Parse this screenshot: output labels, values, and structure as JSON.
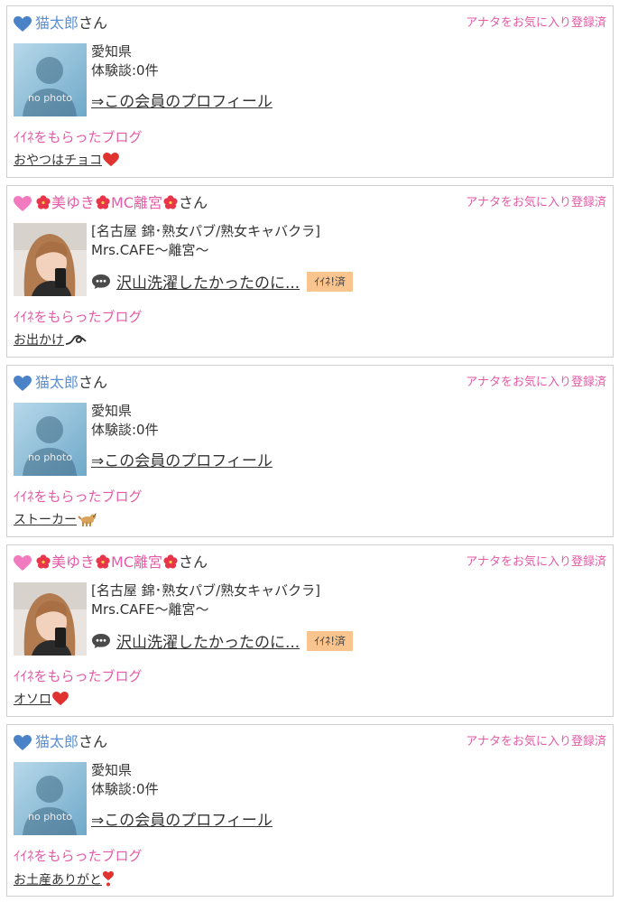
{
  "common": {
    "fav_label": "アナタをお気に入り登録済",
    "received_label": "ｲｲﾈをもらったブログ",
    "san": "さん",
    "profile_link": "⇒この会員のプロフィール",
    "nophoto_text": "no photo"
  },
  "cards": [
    {
      "type": "member",
      "heart": "blue-heart-icon",
      "name": "猫太郎",
      "area": "愛知県",
      "reviews": "体験談:0件",
      "post": "おやつはチョコ",
      "post_emoji": "red-heart-icon"
    },
    {
      "type": "cast",
      "heart": "pink-heart-icon",
      "name_parts": [
        "美ゆき",
        "MC離宮"
      ],
      "shop_category": "[名古屋 錦･熟女パブ/熟女キャバクラ]",
      "shop_name": "Mrs.CAFE〜離宮〜",
      "blog_title": "沢山洗濯したかったのに...",
      "iine_badge": "ｲｲﾈ!済",
      "post": "お出かけ",
      "post_emoji": "curly-loop-icon"
    },
    {
      "type": "member",
      "heart": "blue-heart-icon",
      "name": "猫太郎",
      "area": "愛知県",
      "reviews": "体験談:0件",
      "post": "ストーカー",
      "post_emoji": "dog-icon"
    },
    {
      "type": "cast",
      "heart": "pink-heart-icon",
      "name_parts": [
        "美ゆき",
        "MC離宮"
      ],
      "shop_category": "[名古屋 錦･熟女パブ/熟女キャバクラ]",
      "shop_name": "Mrs.CAFE〜離宮〜",
      "blog_title": "沢山洗濯したかったのに...",
      "iine_badge": "ｲｲﾈ!済",
      "post": "オソロ",
      "post_emoji": "red-heart-icon"
    },
    {
      "type": "member",
      "heart": "blue-heart-icon",
      "name": "猫太郎",
      "area": "愛知県",
      "reviews": "体験談:0件",
      "post": "お土産ありがと",
      "post_emoji": "heart-exclamation-icon"
    }
  ],
  "colors": {
    "pink": "#e45aa6",
    "blue": "#5b8fd1",
    "badge": "#f9c48e",
    "border": "#cfcfcf"
  }
}
